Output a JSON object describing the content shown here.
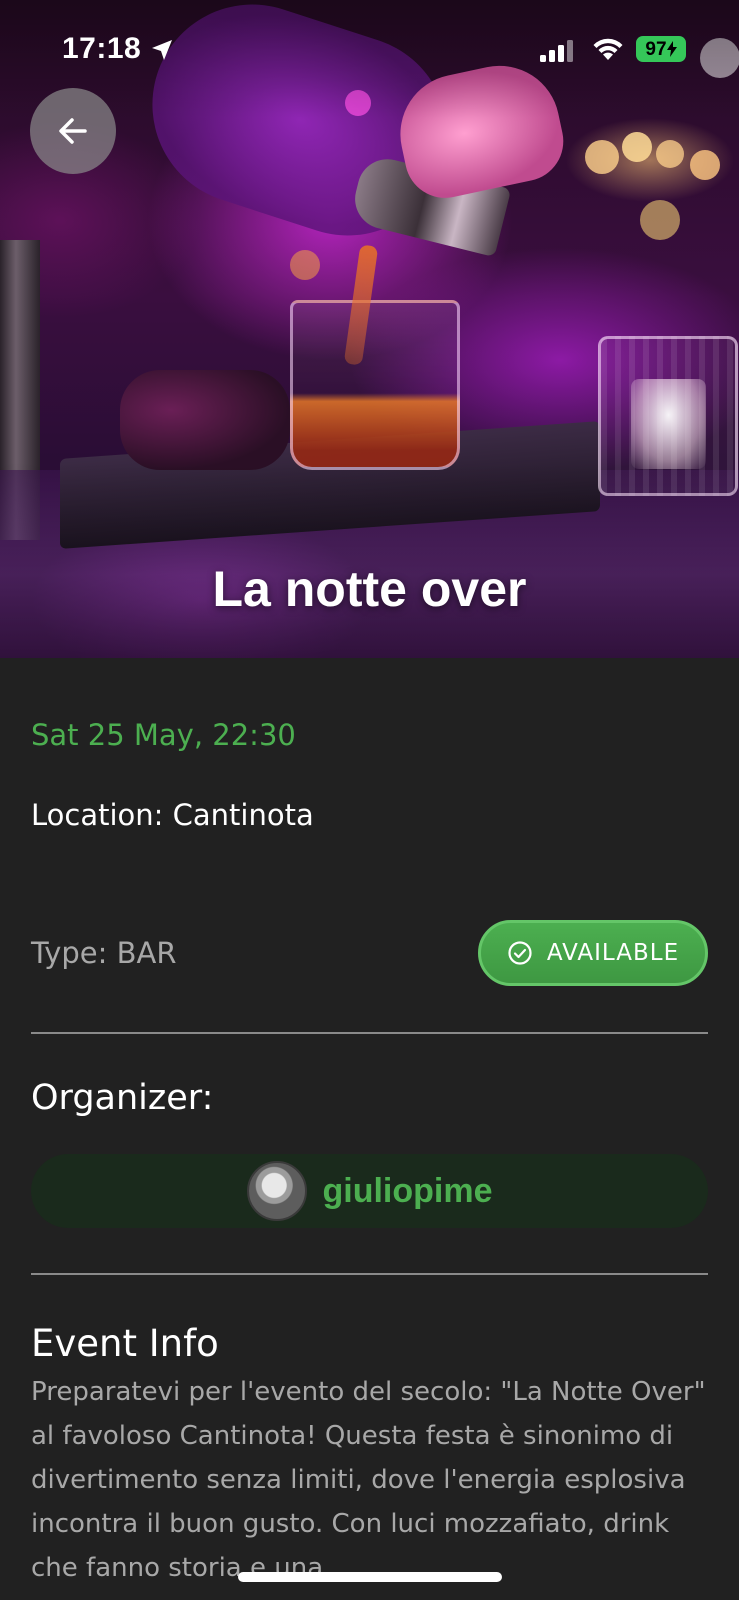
{
  "status_bar": {
    "time": "17:18",
    "battery": "97",
    "battery_color": "#35c759"
  },
  "header": {
    "back_icon": "arrow-left-icon",
    "title": "La notte over"
  },
  "event": {
    "date": "Sat 25 May, 22:30",
    "location": "Location: Cantinota",
    "type": "Type: BAR",
    "status_label": "AVAILABLE",
    "status_icon": "check-circle-icon",
    "status_color": "#4caf50"
  },
  "organizer": {
    "heading": "Organizer:",
    "username": "giuliopime"
  },
  "info": {
    "heading": "Event Info",
    "text": "Preparatevi per l'evento del secolo: \"La Notte Over\" al favoloso Cantinota! Questa festa è sinonimo di divertimento senza limiti, dove l'energia esplosiva incontra il buon gusto. Con luci mozzafiato, drink che fanno storia e una"
  },
  "colors": {
    "background": "#212121",
    "accent": "#4caf50",
    "muted_text": "#a8a8a8"
  }
}
